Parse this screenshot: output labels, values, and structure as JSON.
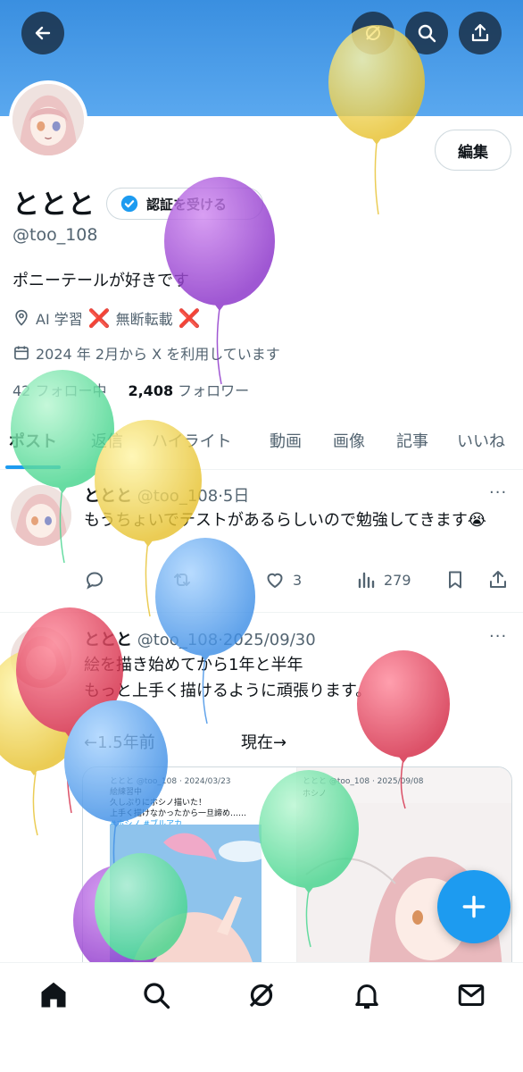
{
  "header": {
    "back_icon": "arrow-left-icon",
    "grok_icon": "grok-icon",
    "search_icon": "search-icon",
    "share_icon": "share-icon"
  },
  "profile": {
    "edit_label": "編集",
    "display_name": "ととと",
    "verify_label": "認証を受ける",
    "handle": "@too_108",
    "bio": "ポニーテールが好きです",
    "location": "AI 学習",
    "location_mark_1": "❌",
    "location_text_2": "無断転載",
    "location_mark_2": "❌",
    "joined": "2024 年 2月から X を利用しています",
    "following_count": "42",
    "following_label": "フォロー中",
    "followers_count": "2,408",
    "followers_label": "フォロワー"
  },
  "tabs": [
    "ポスト",
    "返信",
    "ハイライト",
    "動画",
    "画像",
    "記事",
    "いいね"
  ],
  "active_tab": "ポスト",
  "tweets": [
    {
      "name": "ととと",
      "handle": "@too_108",
      "sep": "·",
      "time": "5日",
      "more": "···",
      "text": "もうちょいでテストがあるらしいので勉強してきます😭",
      "likes": "3",
      "views": "279"
    },
    {
      "name": "ととと",
      "handle": "@too_108",
      "sep": "·",
      "time": "2025/09/30",
      "more": "···",
      "line1": "絵を描き始めてから1年と半年",
      "line2": "もっと上手く描けるように頑張ります。",
      "before_label": "←1.5年前",
      "now_label": "現在→",
      "img_left_meta": "ととと @too_108 · 2024/03/23",
      "img_left_line1": "絵練習中",
      "img_left_line2": "久しぶりにホシノ描いた！",
      "img_left_line3": "上手く描けなかったから一旦諦め……",
      "img_left_line4": "#ホシノ #ブルアカ",
      "img_right_meta": "ととと @too_108 · 2025/09/08",
      "img_right_line1": "ホシノ"
    }
  ],
  "fab_icon": "plus-icon",
  "bottom_nav": [
    "home-icon",
    "search-icon",
    "grok-icon",
    "bell-icon",
    "mail-icon"
  ],
  "colors": {
    "accent": "#1d9bf0",
    "banner": "#4a9ae8"
  }
}
